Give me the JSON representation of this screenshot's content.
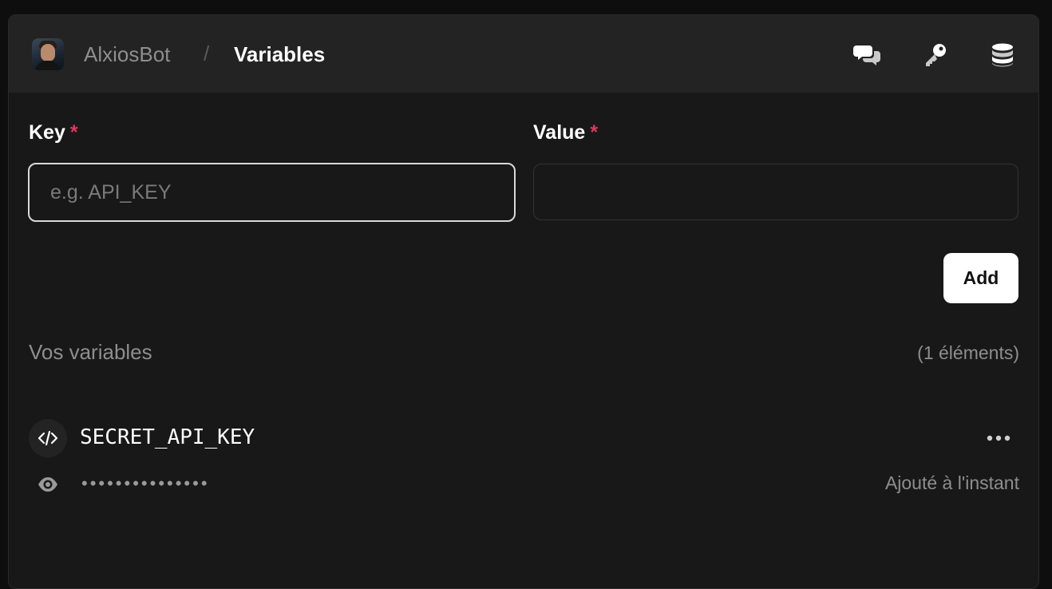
{
  "header": {
    "app_name": "AlxiosBot",
    "separator": "/",
    "page_title": "Variables",
    "icons": [
      "chat-icon",
      "key-icon",
      "database-icon"
    ]
  },
  "form": {
    "key_label": "Key",
    "value_label": "Value",
    "required_mark": "*",
    "key_placeholder": "e.g. API_KEY",
    "key_value": "",
    "value_value": "",
    "add_label": "Add"
  },
  "variables_section": {
    "title": "Vos variables",
    "count_text": "(1 éléments)",
    "items": [
      {
        "key": "SECRET_API_KEY",
        "masked_value": "•••••••••••••••",
        "added": "Ajouté à l'instant",
        "icon": "code-icon"
      }
    ]
  },
  "colors": {
    "background": "#181818",
    "header": "#232323",
    "required": "#e0385a",
    "button": "#ffffff"
  }
}
